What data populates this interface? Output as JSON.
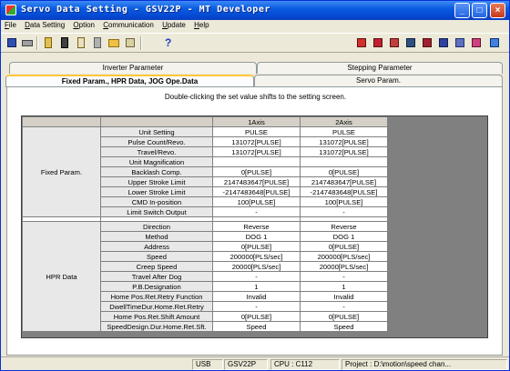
{
  "window": {
    "title": "Servo Data Setting - GSV22P - MT Developer"
  },
  "menu": [
    {
      "u": "F",
      "rest": "ile"
    },
    {
      "u": "D",
      "rest": "ata Setting"
    },
    {
      "u": "O",
      "rest": "ption"
    },
    {
      "u": "C",
      "rest": "ommunication"
    },
    {
      "u": "U",
      "rest": "pdate"
    },
    {
      "u": "H",
      "rest": "elp"
    }
  ],
  "tabs": {
    "top_left": "Inverter Parameter",
    "top_right": "Stepping Parameter",
    "active": "Fixed Param., HPR Data, JOG Ope.Data",
    "right": "Servo Param."
  },
  "hint": "Double-clicking the set value shifts to the setting screen.",
  "grid": {
    "columns": [
      "1Axis",
      "2Axis"
    ],
    "groups": [
      {
        "name": "Fixed Param.",
        "rows": [
          {
            "label": "Unit Setting",
            "a1": "PULSE",
            "a2": "PULSE"
          },
          {
            "label": "Pulse Count/Revo.",
            "a1": "131072[PULSE]",
            "a2": "131072[PULSE]"
          },
          {
            "label": "Travel/Revo.",
            "a1": "131072[PULSE]",
            "a2": "131072[PULSE]"
          },
          {
            "label": "Unit Magnification",
            "a1": "",
            "a2": ""
          },
          {
            "label": "Backlash Comp.",
            "a1": "0[PULSE]",
            "a2": "0[PULSE]"
          },
          {
            "label": "Upper Stroke Limit",
            "a1": "2147483647[PULSE]",
            "a2": "2147483647[PULSE]"
          },
          {
            "label": "Lower Stroke Limit",
            "a1": "-2147483648[PULSE]",
            "a2": "-2147483648[PULSE]"
          },
          {
            "label": "CMD In-position",
            "a1": "100[PULSE]",
            "a2": "100[PULSE]"
          },
          {
            "label": "Limit Switch Output",
            "a1": "-",
            "a2": "-"
          }
        ]
      },
      {
        "name": "HPR Data",
        "rows": [
          {
            "label": "Direction",
            "a1": "Reverse",
            "a2": "Reverse"
          },
          {
            "label": "Method",
            "a1": "DOG 1",
            "a2": "DOG 1"
          },
          {
            "label": "Address",
            "a1": "0[PULSE]",
            "a2": "0[PULSE]"
          },
          {
            "label": "Speed",
            "a1": "200000[PLS/sec]",
            "a2": "200000[PLS/sec]"
          },
          {
            "label": "Creep Speed",
            "a1": "20000[PLS/sec]",
            "a2": "20000[PLS/sec]"
          },
          {
            "label": "Travel After Dog",
            "a1": "-",
            "a2": "-"
          },
          {
            "label": "P.B.Designation",
            "a1": "1",
            "a2": "1"
          },
          {
            "label": "Home Pos.Ret.Retry Function",
            "a1": "Invalid",
            "a2": "Invalid"
          },
          {
            "label": "DwellTimeDur.Home.Ret.Retry",
            "a1": "-",
            "a2": "-"
          },
          {
            "label": "Home Pos.Ret.Shift Amount",
            "a1": "0[PULSE]",
            "a2": "0[PULSE]"
          },
          {
            "label": "SpeedDesign.Dur.Home.Ret.Sft.",
            "a1": "Speed",
            "a2": "Speed"
          }
        ]
      }
    ]
  },
  "status": {
    "usb": "USB",
    "plc": "GSV22P",
    "cpu_label": "CPU :",
    "cpu_value": "C112",
    "project": "Project : D:\\motion\\speed chan..."
  },
  "colors": {
    "title_bar": "#0a5ce0",
    "window_bg": "#ece9d8",
    "grid_gray": "#808080",
    "active_tab_accent": "#ffc83c"
  }
}
